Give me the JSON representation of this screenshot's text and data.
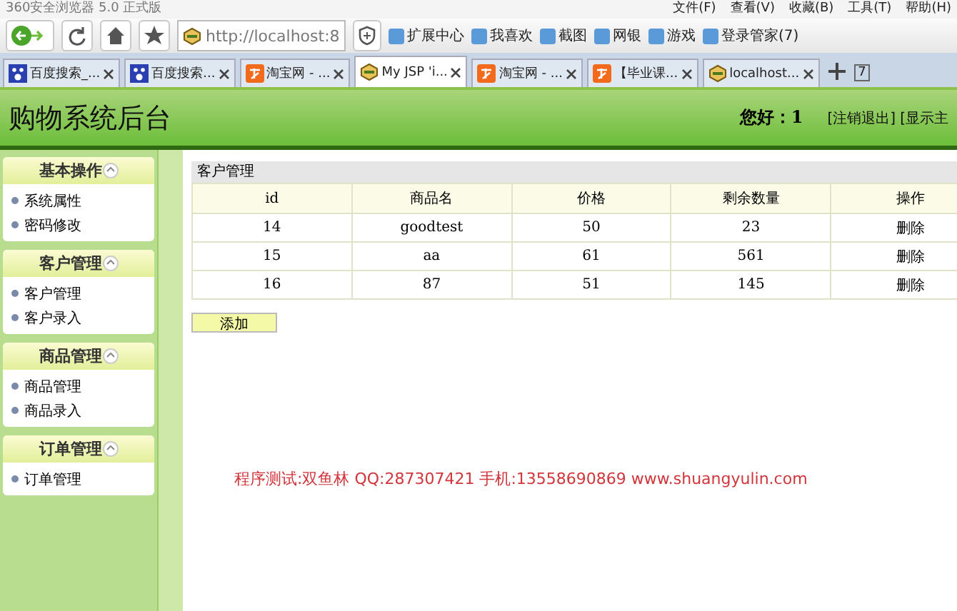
{
  "browser": {
    "title": "360安全浏览器 5.0 正式版",
    "menu": [
      "文件(F)",
      "查看(V)",
      "收藏(B)",
      "工具(T)",
      "帮助(H)"
    ],
    "url": "http://localhost:8",
    "bookmarks": [
      "扩展中心",
      "我喜欢",
      "截图",
      "网银",
      "游戏",
      "登录管家(7)"
    ],
    "tabs": [
      {
        "label": "百度搜索_...",
        "kind": "paw",
        "selected": false
      },
      {
        "label": "百度搜索...",
        "kind": "paw",
        "selected": false
      },
      {
        "label": "淘宝网 - ...",
        "kind": "tao",
        "selected": false
      },
      {
        "label": "My JSP 'i...",
        "kind": "site",
        "selected": true
      },
      {
        "label": "淘宝网 - ...",
        "kind": "tao",
        "selected": false
      },
      {
        "label": "【毕业课...",
        "kind": "tao",
        "selected": false
      },
      {
        "label": "localhost...",
        "kind": "site",
        "selected": false
      }
    ],
    "tab_count": "7"
  },
  "header": {
    "title": "购物系统后台",
    "greeting": "您好：1",
    "links": [
      "[注销退出]",
      "[显示主"
    ]
  },
  "sidebar": {
    "groups": [
      {
        "title": "基本操作",
        "items": [
          "系统属性",
          "密码修改"
        ]
      },
      {
        "title": "客户管理",
        "items": [
          "客户管理",
          "客户录入"
        ]
      },
      {
        "title": "商品管理",
        "items": [
          "商品管理",
          "商品录入"
        ]
      },
      {
        "title": "订单管理",
        "items": [
          "订单管理"
        ]
      }
    ]
  },
  "table": {
    "caption": "客户管理",
    "columns": [
      "id",
      "商品名",
      "价格",
      "剩余数量",
      "操作"
    ],
    "rows": [
      [
        "14",
        "goodtest",
        "50",
        "23",
        "删除"
      ],
      [
        "15",
        "aa",
        "61",
        "561",
        "删除"
      ],
      [
        "16",
        "87",
        "51",
        "145",
        "删除"
      ]
    ]
  },
  "add_button": "添加",
  "note": "程序测试:双鱼林 QQ:287307421 手机:13558690869 www.shuangyulin.com"
}
